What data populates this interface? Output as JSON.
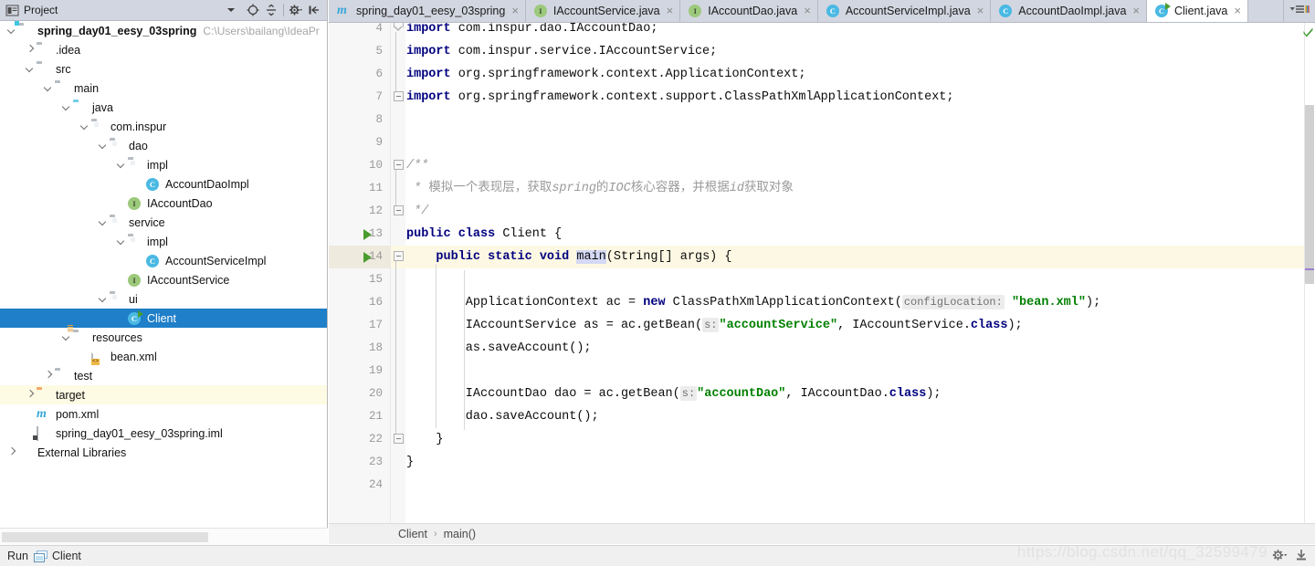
{
  "project_panel": {
    "title": "Project",
    "icons": [
      "project-view-icon",
      "chevron-down-icon",
      "locate-icon",
      "collapse-all-icon",
      "settings-icon",
      "hide-icon"
    ],
    "tree": [
      {
        "label": "spring_day01_eesy_03spring",
        "path": "C:\\Users\\bailang\\IdeaPr",
        "depth": 0,
        "icon": "module-folder-icon",
        "arrow": "down",
        "bold": true
      },
      {
        "label": ".idea",
        "depth": 1,
        "icon": "folder-icon",
        "arrow": "right"
      },
      {
        "label": "src",
        "depth": 1,
        "icon": "folder-icon",
        "arrow": "down"
      },
      {
        "label": "main",
        "depth": 2,
        "icon": "folder-icon",
        "arrow": "down"
      },
      {
        "label": "java",
        "depth": 3,
        "icon": "source-folder-icon",
        "arrow": "down"
      },
      {
        "label": "com.inspur",
        "depth": 4,
        "icon": "package-icon",
        "arrow": "down"
      },
      {
        "label": "dao",
        "depth": 5,
        "icon": "package-icon",
        "arrow": "down"
      },
      {
        "label": "impl",
        "depth": 6,
        "icon": "package-icon",
        "arrow": "down"
      },
      {
        "label": "AccountDaoImpl",
        "depth": 7,
        "icon": "class-icon"
      },
      {
        "label": "IAccountDao",
        "depth": 6,
        "icon": "interface-icon"
      },
      {
        "label": "service",
        "depth": 5,
        "icon": "package-icon",
        "arrow": "down"
      },
      {
        "label": "impl",
        "depth": 6,
        "icon": "package-icon",
        "arrow": "down"
      },
      {
        "label": "AccountServiceImpl",
        "depth": 7,
        "icon": "class-icon"
      },
      {
        "label": "IAccountService",
        "depth": 6,
        "icon": "interface-icon"
      },
      {
        "label": "ui",
        "depth": 5,
        "icon": "package-icon",
        "arrow": "down"
      },
      {
        "label": "Client",
        "depth": 6,
        "icon": "runnable-class-icon",
        "selected": true
      },
      {
        "label": "resources",
        "depth": 3,
        "icon": "resources-folder-icon",
        "arrow": "down"
      },
      {
        "label": "bean.xml",
        "depth": 4,
        "icon": "xml-file-icon"
      },
      {
        "label": "test",
        "depth": 2,
        "icon": "folder-icon",
        "arrow": "right"
      },
      {
        "label": "target",
        "depth": 1,
        "icon": "target-folder-icon",
        "arrow": "right",
        "highlight": true
      },
      {
        "label": "pom.xml",
        "depth": 1,
        "icon": "maven-icon"
      },
      {
        "label": "spring_day01_eesy_03spring.iml",
        "depth": 1,
        "icon": "iml-file-icon"
      },
      {
        "label": "External Libraries",
        "depth": 0,
        "icon": "library-icon",
        "arrow": "right"
      }
    ]
  },
  "tabs": [
    {
      "label": "spring_day01_eesy_03spring",
      "icon": "maven-icon",
      "active": false,
      "closable": true
    },
    {
      "label": "IAccountService.java",
      "icon": "interface-icon",
      "active": false,
      "closable": true
    },
    {
      "label": "IAccountDao.java",
      "icon": "interface-icon",
      "active": false,
      "closable": true
    },
    {
      "label": "AccountServiceImpl.java",
      "icon": "class-icon",
      "active": false,
      "closable": true
    },
    {
      "label": "AccountDaoImpl.java",
      "icon": "class-icon",
      "active": false,
      "closable": true
    },
    {
      "label": "Client.java",
      "icon": "runnable-class-icon",
      "active": true,
      "closable": true
    }
  ],
  "tabbar_right_icon": "tab-list-icon",
  "editor": {
    "lines": [
      {
        "n": "4",
        "indent": 0,
        "html": "<span class=\"kw\">import</span> com.inspur.dao.IAccountDao;"
      },
      {
        "n": "5",
        "indent": 0,
        "html": "<span class=\"kw\">import</span> com.inspur.service.IAccountService;"
      },
      {
        "n": "6",
        "indent": 0,
        "html": "<span class=\"kw\">import</span> org.springframework.context.ApplicationContext;"
      },
      {
        "n": "7",
        "indent": 0,
        "html": "<span class=\"kw\">import</span> org.springframework.context.support.ClassPathXmlApplicationContext;"
      },
      {
        "n": "8",
        "indent": 0,
        "html": ""
      },
      {
        "n": "9",
        "indent": 0,
        "html": ""
      },
      {
        "n": "10",
        "indent": 0,
        "html": "<span class=\"cmt\">/**</span>"
      },
      {
        "n": "11",
        "indent": 0,
        "html": "<span class=\"cmt\"> * <span class=\"cn\">模拟一个表现层，获取</span>spring<span class=\"cn\">的</span>IOC<span class=\"cn\">核心容器，并根据</span>id<span class=\"cn\">获取对象</span></span>"
      },
      {
        "n": "12",
        "indent": 0,
        "html": "<span class=\"cmt\"> */</span>"
      },
      {
        "n": "13",
        "indent": 0,
        "html": "<span class=\"kw\">public class</span> Client {",
        "run": true
      },
      {
        "n": "14",
        "indent": 0,
        "html": "    <span class=\"kw\">public static void</span> <span class=\"sel\">main</span>(String[] args) {",
        "run": true,
        "bulb": true,
        "highlight": true
      },
      {
        "n": "15",
        "indent": 0,
        "html": ""
      },
      {
        "n": "16",
        "indent": 0,
        "html": "        ApplicationContext ac = <span class=\"kw\">new</span> ClassPathXmlApplicationContext(<span class=\"hint\">configLocation:</span> <span class=\"str\">\"bean.xml\"</span>);"
      },
      {
        "n": "17",
        "indent": 0,
        "html": "        IAccountService as = ac.getBean(<span class=\"hint\">s:</span><span class=\"str\">\"accountService\"</span>, IAccountService.<span class=\"kw\">class</span>);"
      },
      {
        "n": "18",
        "indent": 0,
        "html": "        as.saveAccount();"
      },
      {
        "n": "19",
        "indent": 0,
        "html": ""
      },
      {
        "n": "20",
        "indent": 0,
        "html": "        IAccountDao dao = ac.getBean(<span class=\"hint\">s:</span><span class=\"str\">\"accountDao\"</span>, IAccountDao.<span class=\"kw\">class</span>);"
      },
      {
        "n": "21",
        "indent": 0,
        "html": "        dao.saveAccount();"
      },
      {
        "n": "22",
        "indent": 0,
        "html": "    }"
      },
      {
        "n": "23",
        "indent": 0,
        "html": "}"
      },
      {
        "n": "24",
        "indent": 0,
        "html": ""
      }
    ],
    "inspection_status": "ok-check-icon"
  },
  "breadcrumb": {
    "items": [
      "Client",
      "main()"
    ],
    "separator": "›"
  },
  "statusbar": {
    "run_label": "Run",
    "run_target": "Client",
    "watermark": "https://blog.csdn.net/qq_32599479",
    "icons": [
      "gear-icon",
      "download-icon"
    ]
  }
}
